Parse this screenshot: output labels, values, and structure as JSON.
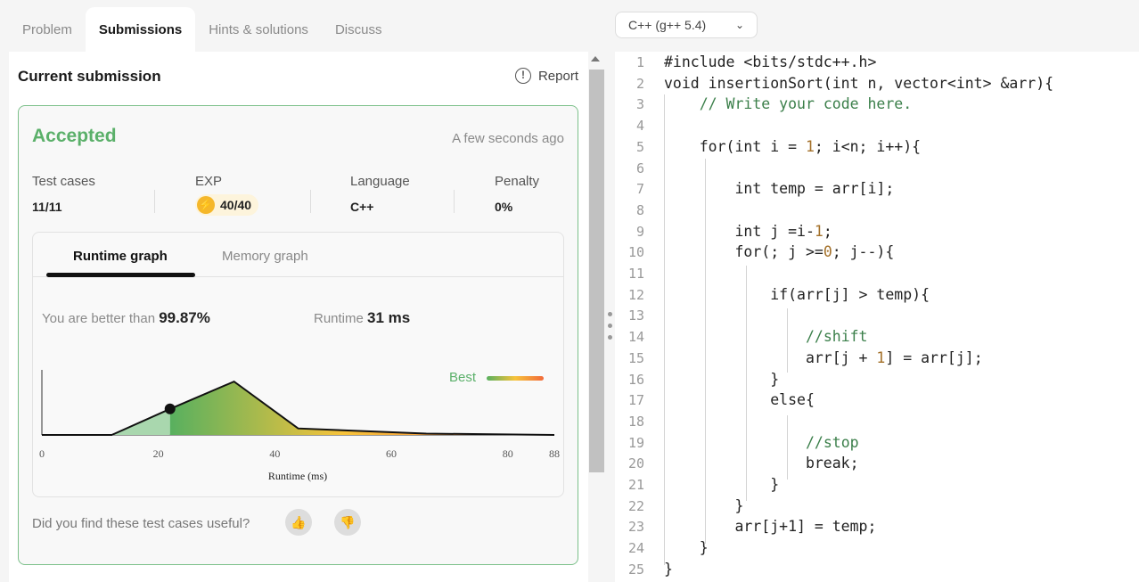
{
  "tabs": [
    {
      "label": "Problem"
    },
    {
      "label": "Submissions"
    },
    {
      "label": "Hints & solutions"
    },
    {
      "label": "Discuss"
    }
  ],
  "submission": {
    "title": "Current submission",
    "report_label": "Report",
    "status": "Accepted",
    "time_ago": "A few seconds ago",
    "stats": {
      "test_cases_label": "Test cases",
      "test_cases_value": "11/11",
      "exp_label": "EXP",
      "exp_value": "40/40",
      "language_label": "Language",
      "language_value": "C++",
      "penalty_label": "Penalty",
      "penalty_value": "0%"
    },
    "graph": {
      "tab_runtime": "Runtime graph",
      "tab_memory": "Memory graph",
      "better_label": "You are better than",
      "better_value": "99.87%",
      "runtime_label": "Runtime",
      "runtime_value": "31 ms",
      "best_label": "Best"
    },
    "feedback_question": "Did you find these test cases useful?"
  },
  "chart_data": {
    "type": "area",
    "xlabel": "Runtime (ms)",
    "ylabel": "",
    "xlim": [
      0,
      88
    ],
    "x_ticks": [
      "0",
      "20",
      "40",
      "60",
      "80",
      "88"
    ],
    "x": [
      0,
      12,
      22,
      33,
      44,
      66,
      88
    ],
    "values": [
      0,
      0,
      0.4,
      0.82,
      0.1,
      0.02,
      0
    ],
    "marker_x": 22,
    "legend": "top-right"
  },
  "editor": {
    "language": "C++ (g++ 5.4)",
    "lines": [
      {
        "n": "1",
        "text": "#include <bits/stdc++.h>"
      },
      {
        "n": "2",
        "text": "void insertionSort(int n, vector<int> &arr){"
      },
      {
        "n": "3",
        "text": "    // Write your code here."
      },
      {
        "n": "4",
        "text": ""
      },
      {
        "n": "5",
        "text": "    for(int i = 1; i<n; i++){"
      },
      {
        "n": "6",
        "text": ""
      },
      {
        "n": "7",
        "text": "        int temp = arr[i];"
      },
      {
        "n": "8",
        "text": ""
      },
      {
        "n": "9",
        "text": "        int j =i-1;"
      },
      {
        "n": "10",
        "text": "        for(; j >=0; j--){"
      },
      {
        "n": "11",
        "text": ""
      },
      {
        "n": "12",
        "text": "            if(arr[j] > temp){"
      },
      {
        "n": "13",
        "text": ""
      },
      {
        "n": "14",
        "text": "                //shift"
      },
      {
        "n": "15",
        "text": "                arr[j + 1] = arr[j];"
      },
      {
        "n": "16",
        "text": "            }"
      },
      {
        "n": "17",
        "text": "            else{"
      },
      {
        "n": "18",
        "text": ""
      },
      {
        "n": "19",
        "text": "                //stop"
      },
      {
        "n": "20",
        "text": "                break;"
      },
      {
        "n": "21",
        "text": "            }"
      },
      {
        "n": "22",
        "text": "        }"
      },
      {
        "n": "23",
        "text": "        arr[j+1] = temp;"
      },
      {
        "n": "24",
        "text": "    }"
      },
      {
        "n": "25",
        "text": "}"
      }
    ]
  },
  "colors": {
    "accent_green": "#5bb06a",
    "gradient_start": "#58b05f",
    "gradient_mid": "#f7c33b",
    "gradient_end": "#f26a3a"
  }
}
